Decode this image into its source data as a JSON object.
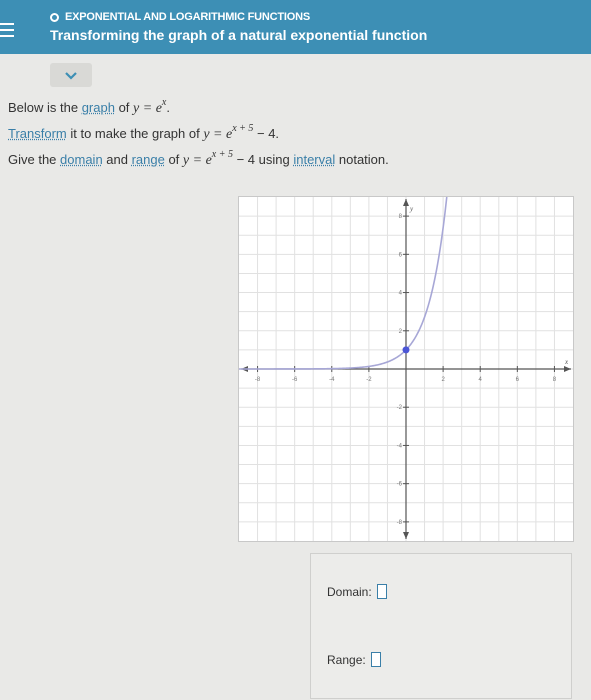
{
  "header": {
    "topic": "EXPONENTIAL AND LOGARITHMIC FUNCTIONS",
    "title": "Transforming the graph of a natural exponential function"
  },
  "problem": {
    "line1_a": "Below is the ",
    "line1_link": "graph",
    "line1_b": " of ",
    "line1_math": "y = e",
    "line1_exp": "x",
    "line1_end": ".",
    "line2_link": "Transform",
    "line2_b": " it to make the graph of ",
    "line2_math": "y = e",
    "line2_exp": "x + 5",
    "line2_end": " − 4.",
    "line3_a": "Give the ",
    "line3_link1": "domain",
    "line3_b": " and ",
    "line3_link2": "range",
    "line3_c": " of ",
    "line3_math": "y = e",
    "line3_exp": "x + 5",
    "line3_d": " − 4 using ",
    "line3_link3": "interval",
    "line3_e": " notation."
  },
  "graph": {
    "x_axis_label": "x",
    "y_axis_label": "y",
    "x_ticks": [
      "-8",
      "-6",
      "-4",
      "-2",
      "2",
      "4",
      "6",
      "8"
    ],
    "y_ticks": [
      "8",
      "6",
      "4",
      "2",
      "-2",
      "-4",
      "-6",
      "-8"
    ],
    "curve_color": "#a7a7d6",
    "point_color": "#4b55d6",
    "point": {
      "x": 0,
      "y": 1
    }
  },
  "answers": {
    "domain_label": "Domain:",
    "range_label": "Range:"
  }
}
